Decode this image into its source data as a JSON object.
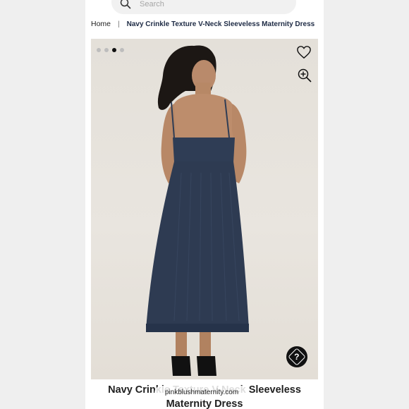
{
  "search": {
    "placeholder": "Search"
  },
  "breadcrumb": {
    "home": "Home",
    "separator": "|",
    "current": "Navy Crinkle Texture V-Neck Sleeveless Maternity Dress"
  },
  "gallery": {
    "image_count": 4,
    "active_index": 2,
    "dress_color": "#2f3d55",
    "help_label": "?"
  },
  "product": {
    "title_line1": "Navy Crinkle Texture V-Neck Sleeveless",
    "title_line2": "Maternity Dress"
  },
  "watermark": "pinkblushmaternity.com",
  "icons": [
    "search-icon",
    "heart-icon",
    "zoom-in-icon",
    "help-icon"
  ]
}
